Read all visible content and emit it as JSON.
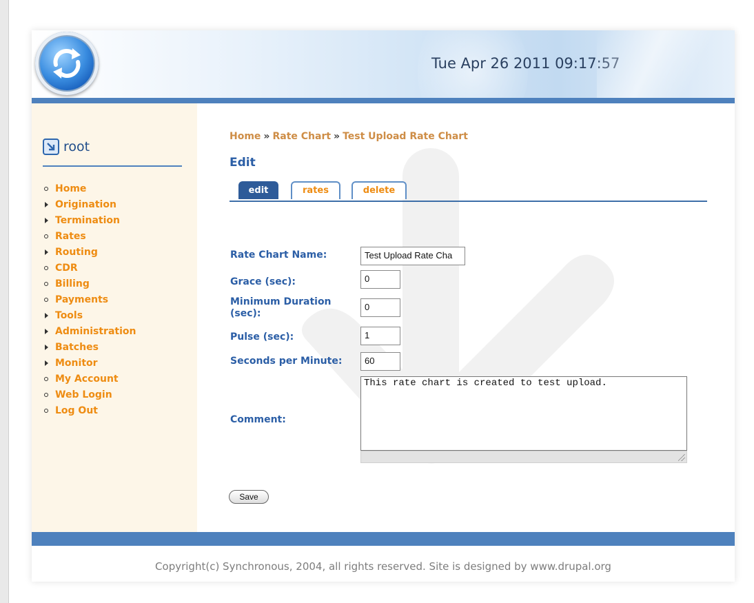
{
  "header": {
    "datetime": "Tue Apr 26 2011 09:17:57"
  },
  "colors": {
    "accent": "#4e81bd",
    "link": "#ee8c12",
    "label": "#2b5ea6",
    "sidebar_bg": "#fdf6e8"
  },
  "sidebar": {
    "user": "root",
    "items": [
      {
        "label": "Home",
        "marker": "bullet"
      },
      {
        "label": "Origination",
        "marker": "arrow"
      },
      {
        "label": "Termination",
        "marker": "arrow"
      },
      {
        "label": "Rates",
        "marker": "bullet"
      },
      {
        "label": "Routing",
        "marker": "arrow"
      },
      {
        "label": "CDR",
        "marker": "bullet"
      },
      {
        "label": "Billing",
        "marker": "bullet"
      },
      {
        "label": "Payments",
        "marker": "bullet"
      },
      {
        "label": "Tools",
        "marker": "arrow"
      },
      {
        "label": "Administration",
        "marker": "arrow"
      },
      {
        "label": "Batches",
        "marker": "arrow"
      },
      {
        "label": "Monitor",
        "marker": "arrow"
      },
      {
        "label": "My Account",
        "marker": "bullet"
      },
      {
        "label": "Web Login",
        "marker": "bullet"
      },
      {
        "label": "Log Out",
        "marker": "bullet"
      }
    ]
  },
  "breadcrumb": {
    "home": "Home",
    "sep": "»",
    "rate_chart": "Rate Chart",
    "current": "Test Upload Rate Chart"
  },
  "page_title": "Edit",
  "tabs": {
    "edit": "edit",
    "rates": "rates",
    "delete": "delete"
  },
  "form": {
    "rate_chart_name": {
      "label": "Rate Chart Name:",
      "value": "Test Upload Rate Cha"
    },
    "grace": {
      "label": "Grace (sec):",
      "value": "0"
    },
    "minimum_duration": {
      "label": "Minimum Duration (sec):",
      "value": "0"
    },
    "pulse": {
      "label": "Pulse (sec):",
      "value": "1"
    },
    "seconds_per_minute": {
      "label": "Seconds per Minute:",
      "value": "60"
    },
    "comment": {
      "label": "Comment:",
      "value": "This rate chart is created to test upload."
    },
    "save_label": "Save"
  },
  "footer": {
    "text": "Copyright(c) Synchronous, 2004, all rights reserved. Site is designed by www.drupal.org"
  }
}
